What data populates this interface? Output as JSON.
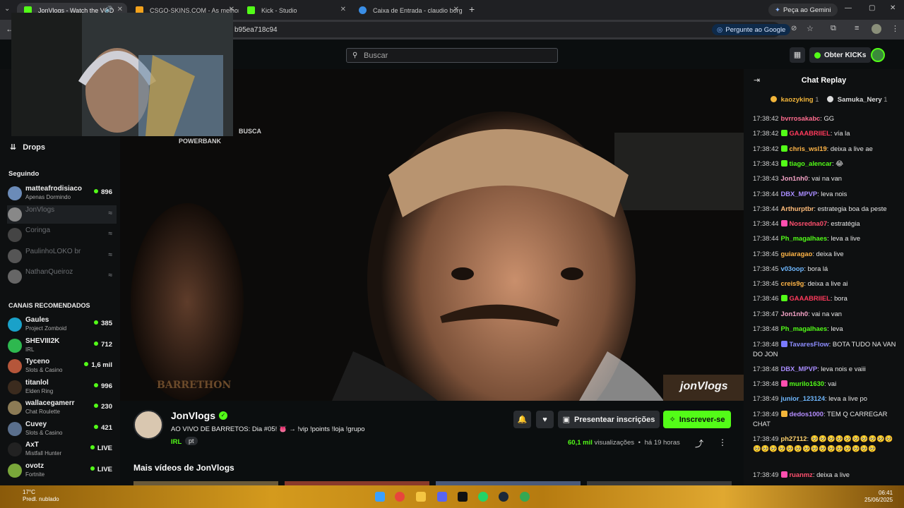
{
  "browser": {
    "tabs": [
      {
        "label": "JonVlogs - Watch the VOD",
        "color": "#53fc18"
      },
      {
        "label": "CSGO-SKINS.COM - As melhor",
        "color": "#f3a21c"
      },
      {
        "label": "Kick - Studio",
        "color": "#53fc18"
      },
      {
        "label": "Caixa de Entrada - claudio borg",
        "color": "#3a8ee6"
      }
    ],
    "gemini_label": "Peça ao Gemini",
    "url_text": "b95ea718c94",
    "ask_google_label": "Pergunte ao Google"
  },
  "kick": {
    "search_placeholder": "Buscar",
    "get_kicks_label": "Obter KICKs"
  },
  "sidebar": {
    "drops_label": "Drops",
    "following_title": "Seguindo",
    "following": [
      {
        "name": "matteafrodisiaco",
        "sub": "Apenas Dormindo",
        "count": "896",
        "color": "#6b8bb8",
        "live": true
      },
      {
        "name": "JonVlogs",
        "sub": "",
        "count": "≈",
        "color": "#888888",
        "live": false
      },
      {
        "name": "Coringa",
        "sub": "",
        "count": "≈",
        "color": "#444444",
        "live": false
      },
      {
        "name": "PaulinhoLOKO br",
        "sub": "",
        "count": "≈",
        "color": "#555555",
        "live": false
      },
      {
        "name": "NathanQueiroz",
        "sub": "",
        "count": "≈",
        "color": "#666666",
        "live": false
      }
    ],
    "recommended_title": "CANAIS RECOMENDADOS",
    "recommended": [
      {
        "name": "Gaules",
        "sub": "Project Zomboid",
        "count": "385",
        "color": "#1aa1c9"
      },
      {
        "name": "SHEVIII2K",
        "sub": "IRL",
        "count": "712",
        "color": "#2eb84f"
      },
      {
        "name": "Tyceno",
        "sub": "Slots & Casino",
        "count": "1,6 mil",
        "color": "#b5563a"
      },
      {
        "name": "titanlol",
        "sub": "Elden Ring",
        "count": "996",
        "color": "#3b2b1e"
      },
      {
        "name": "wallacegamerr",
        "sub": "Chat Roulette",
        "count": "230",
        "color": "#8c7b55"
      },
      {
        "name": "Cuvey",
        "sub": "Slots & Casino",
        "count": "421",
        "color": "#5a6f8c"
      },
      {
        "name": "AxT",
        "sub": "Mistfall Hunter",
        "count": "LIVE",
        "color": "#222222"
      },
      {
        "name": "ovotz",
        "sub": "Fortnite",
        "count": "LIVE",
        "color": "#7aa73a"
      }
    ]
  },
  "video": {
    "overlay_text_1": "BUSCA",
    "overlay_text_2": "POWERBANK",
    "watermark_1": "BARRETHON",
    "watermark_2": "jonVlogs"
  },
  "stream": {
    "channel": "JonVlogs",
    "title": "AO VIVO DE BARRETOS: Dia #05! 👅 → !vip !points !loja !grupo",
    "tag": "IRL",
    "lang": "pt",
    "views_num": "60,1 mil",
    "views_label": "visualizações",
    "ago": "há 19 horas",
    "gift_label": "Presentear inscrições",
    "subscribe_label": "Inscrever-se",
    "more_videos": "Mais vídeos de JonVlogs"
  },
  "chat": {
    "title": "Chat Replay",
    "top_gifters": [
      {
        "name": "kaozyking",
        "count": "1",
        "color": "#f2b53a"
      },
      {
        "name": "Samuka_Nery",
        "count": "1",
        "color": "#dcdcdc"
      }
    ],
    "messages": [
      {
        "time": "17:38:42",
        "user": "bvrrosakabc",
        "color": "#ff6d8f",
        "text": "GG",
        "badge": ""
      },
      {
        "time": "17:38:42",
        "user": "GAAABRIIEL",
        "color": "#ff3a5c",
        "text": "vía la",
        "badge": "#53fc18"
      },
      {
        "time": "17:38:42",
        "user": "chris_wsl19",
        "color": "#ffb547",
        "text": "deixa a live ae",
        "badge": "#53fc18"
      },
      {
        "time": "17:38:43",
        "user": "tiago_alencar",
        "color": "#53fc18",
        "text": "😂",
        "badge": "#53fc18"
      },
      {
        "time": "17:38:43",
        "user": "Jon1nh0",
        "color": "#f4a3c6",
        "text": "vai na van",
        "badge": ""
      },
      {
        "time": "17:38:44",
        "user": "DBX_MPVP",
        "color": "#a98dff",
        "text": "leva nois",
        "badge": ""
      },
      {
        "time": "17:38:44",
        "user": "Arthurptbr",
        "color": "#ffbc7a",
        "text": "estrategia boa da peste",
        "badge": ""
      },
      {
        "time": "17:38:44",
        "user": "Nosredna07",
        "color": "#ff4f6e",
        "text": "estratégia",
        "badge": "#ff4fb0"
      },
      {
        "time": "17:38:44",
        "user": "Ph_magalhaes",
        "color": "#53fc18",
        "text": "leva a live",
        "badge": ""
      },
      {
        "time": "17:38:45",
        "user": "guiaragao",
        "color": "#ffb547",
        "text": "deixa live",
        "badge": ""
      },
      {
        "time": "17:38:45",
        "user": "v03oop",
        "color": "#6fb8ff",
        "text": "bora lá",
        "badge": ""
      },
      {
        "time": "17:38:45",
        "user": "creis9g",
        "color": "#ffb547",
        "text": "deixa a live ai",
        "badge": ""
      },
      {
        "time": "17:38:46",
        "user": "GAAABRIIEL",
        "color": "#ff3a5c",
        "text": "bora",
        "badge": "#53fc18"
      },
      {
        "time": "17:38:47",
        "user": "Jon1nh0",
        "color": "#f4a3c6",
        "text": "vai na van",
        "badge": ""
      },
      {
        "time": "17:38:48",
        "user": "Ph_magalhaes",
        "color": "#53fc18",
        "text": "leva",
        "badge": ""
      },
      {
        "time": "17:38:48",
        "user": "TavaresFlow",
        "color": "#8d8dff",
        "text": "BOTA TUDO NA VAN DO JON",
        "badge": "#7a7aff"
      },
      {
        "time": "17:38:48",
        "user": "DBX_MPVP",
        "color": "#a98dff",
        "text": "leva nois e vaiii",
        "badge": ""
      },
      {
        "time": "17:38:48",
        "user": "murilo1630",
        "color": "#53fc18",
        "text": "vai",
        "badge": "#ff4fb0"
      },
      {
        "time": "17:38:49",
        "user": "junior_123124",
        "color": "#6fb8ff",
        "text": "leva a live po",
        "badge": ""
      },
      {
        "time": "17:38:49",
        "user": "dedos1000",
        "color": "#b48dff",
        "text": "TEM Q CARREGAR CHAT",
        "badge": "#f2b53a"
      },
      {
        "time": "17:38:49",
        "user": "ph27112",
        "color": "#ffd36e",
        "text": "🥺🥺🥺🥺🥺🥺🥺🥺🥺🥺🥺🥺🥺🥺🥺🥺🥺🥺🥺🥺🥺🥺🥺🥺🥺",
        "badge": ""
      },
      {
        "time": "17:38:49",
        "user": "ruanmz",
        "color": "#ff4f6e",
        "text": "deixa a live",
        "badge": "#ff4fb0"
      }
    ]
  },
  "taskbar": {
    "weather_temp": "17°C",
    "weather_desc": "Predl. nublado",
    "time": "06:41",
    "date": "25/06/2025"
  }
}
